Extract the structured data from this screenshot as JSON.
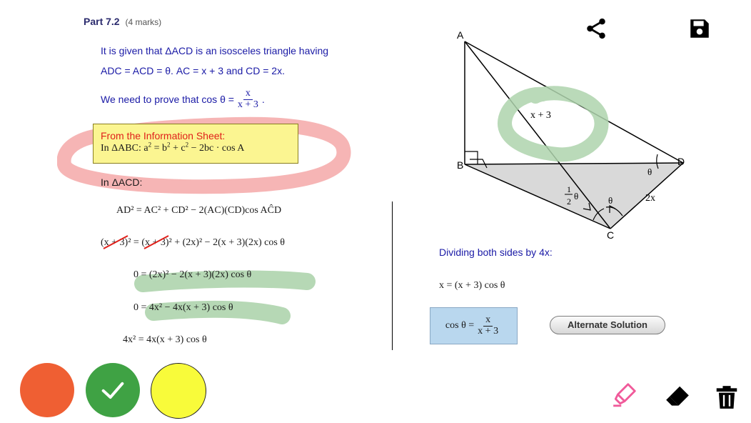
{
  "header": {
    "part_label": "Part 7.2",
    "marks": "(4 marks)"
  },
  "problem": {
    "given_line1": "It is given that ΔACD is an isosceles triangle having",
    "given_line2_a": "AD",
    "given_line2_b": "C = AC",
    "given_line2_c": "D = θ. AC = x + 3 and CD = 2x.",
    "prove_text": "We need to prove that cos θ =",
    "prove_num": "x",
    "prove_den": "x + 3",
    "prove_end": "."
  },
  "info_sheet": {
    "title": "From the Information Sheet:",
    "formula_prefix": "In ΔABC: a",
    "formula_mid1": " = b",
    "formula_mid2": " + c",
    "formula_end": " − 2bc · cos A",
    "exp": "2"
  },
  "working": {
    "in_acd": "In ΔACD:",
    "line1": "AD² = AC² + CD² − 2(AC)(CD)cos AĈD",
    "line2_a": "(x + 3)²",
    "line2_b": " = ",
    "line2_c": "(x + 3)²",
    "line2_d": " + (2x)² − 2(x + 3)(2x) cos θ",
    "line3": "0 = (2x)² − 2(x + 3)(2x) cos θ",
    "line4": "0 = 4x² − 4x(x + 3) cos θ",
    "line5": "4x² = 4x(x + 3) cos θ"
  },
  "diagram": {
    "label_a": "A",
    "label_b": "B",
    "label_c": "C",
    "label_d": "D",
    "side_ac": "x + 3",
    "side_cd": "2x",
    "angle_d": "θ",
    "angle_c": "θ",
    "half_num": "1",
    "half_den": "2",
    "half_theta": "θ"
  },
  "right_panel": {
    "dividing_text": "Dividing both sides by 4x:",
    "eq_line": "x = (x + 3) cos θ",
    "result_lhs": "cos θ =",
    "result_num": "x",
    "result_den": "x + 3",
    "alternate_button": "Alternate Solution"
  },
  "toolbar": {
    "share_icon": "share-icon",
    "save_icon": "save-icon",
    "highlighter_icon": "highlighter-icon",
    "eraser_icon": "eraser-icon",
    "trash_icon": "trash-icon"
  },
  "colors": {
    "orange": "#ef5f33",
    "green": "#3fa244",
    "yellow": "#f8fb3a",
    "highlight_red": "#f4a8a8",
    "highlight_green": "#aed4ad",
    "pen_pink": "#f05a9a"
  }
}
